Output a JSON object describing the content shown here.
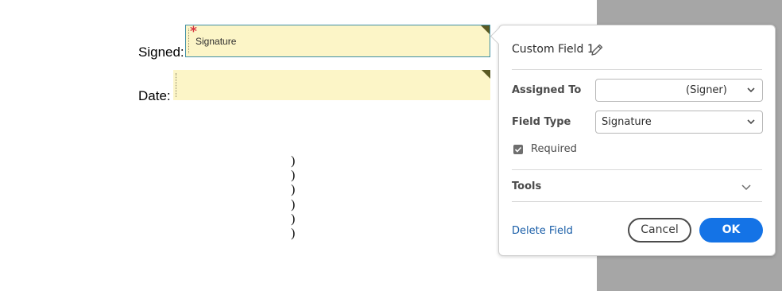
{
  "document": {
    "signed_label": "Signed:",
    "date_label": "Date:",
    "signature_field": {
      "name": "Signature",
      "required_marker": "*"
    },
    "parentheses": [
      ")",
      ")",
      ")",
      ")",
      ")",
      ")"
    ]
  },
  "popover": {
    "title": "Custom Field 1",
    "title_icon": "pencil-icon",
    "assigned_to": {
      "label": "Assigned To",
      "value": "(Signer)"
    },
    "field_type": {
      "label": "Field Type",
      "value": "Signature"
    },
    "required": {
      "label": "Required",
      "checked": true
    },
    "tools": {
      "label": "Tools",
      "icon": "chevron-down-icon"
    },
    "delete_label": "Delete Field",
    "cancel_label": "Cancel",
    "ok_label": "OK"
  },
  "colors": {
    "field_fill": "#fcf5c7",
    "selected_border": "#3f8fa5",
    "required_star": "#d7373f",
    "primary_button": "#1473e6",
    "link": "#1a5ea8",
    "backdrop": "#a6a6a6"
  }
}
